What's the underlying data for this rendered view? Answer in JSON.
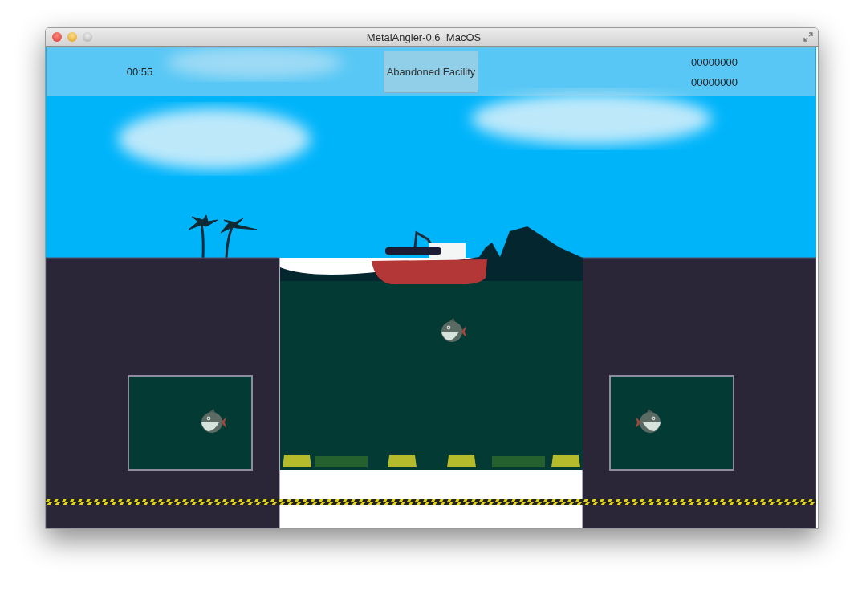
{
  "window": {
    "title": "MetalAngler-0.6_MacOS"
  },
  "hud": {
    "timer": "00:55",
    "level_name": "Abandoned Facility",
    "scores": [
      "00000000",
      "00000000"
    ]
  }
}
